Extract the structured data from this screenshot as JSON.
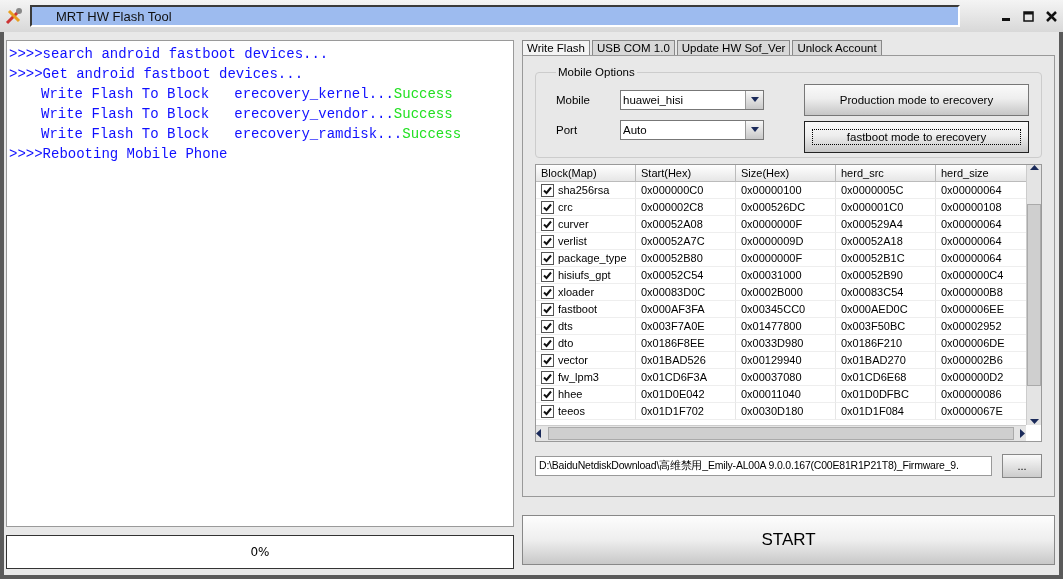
{
  "window": {
    "title": "MRT HW Flash Tool"
  },
  "log": [
    {
      "kind": "prompt",
      "parts": [
        {
          "text": ">>>>search android fastboot devices..."
        }
      ]
    },
    {
      "kind": "prompt",
      "parts": [
        {
          "text": ">>>>Get android fastboot devices..."
        }
      ]
    },
    {
      "kind": "step",
      "parts": [
        {
          "text": "Write Flash To Block   erecovery_kernel..."
        },
        {
          "text": "Success",
          "kind": "success"
        }
      ]
    },
    {
      "kind": "step",
      "parts": [
        {
          "text": "Write Flash To Block   erecovery_vendor..."
        },
        {
          "text": "Success",
          "kind": "success"
        }
      ]
    },
    {
      "kind": "step",
      "parts": [
        {
          "text": "Write Flash To Block   erecovery_ramdisk..."
        },
        {
          "text": "Success",
          "kind": "success"
        }
      ]
    },
    {
      "kind": "prompt",
      "parts": [
        {
          "text": ">>>>Rebooting Mobile Phone"
        }
      ]
    }
  ],
  "progress": {
    "level": 0,
    "reading": "0%"
  },
  "tabs": [
    {
      "label": "Write Flash",
      "selected": true
    },
    {
      "label": "USB COM 1.0",
      "selected": false
    },
    {
      "label": "Update HW Sof_Ver",
      "selected": false
    },
    {
      "label": "Unlock Account",
      "selected": false
    }
  ],
  "mobile_options": {
    "title": "Mobile Options",
    "fields": [
      {
        "label": "Mobile",
        "value": "huawei_hisi"
      },
      {
        "label": "Port",
        "value": "Auto"
      }
    ],
    "buttons": [
      {
        "label": "Production mode to erecovery",
        "focused": false
      },
      {
        "label": "fastboot mode to erecovery",
        "focused": true
      }
    ]
  },
  "table": {
    "columns": [
      "Block(Map)",
      "Start(Hex)",
      "Size(Hex)",
      "herd_src",
      "herd_size"
    ],
    "rows": [
      {
        "checked": true,
        "cells": [
          "sha256rsa",
          "0x000000C0",
          "0x00000100",
          "0x0000005C",
          "0x00000064"
        ]
      },
      {
        "checked": true,
        "cells": [
          "crc",
          "0x000002C8",
          "0x000526DC",
          "0x000001C0",
          "0x00000108"
        ]
      },
      {
        "checked": true,
        "cells": [
          "curver",
          "0x00052A08",
          "0x0000000F",
          "0x000529A4",
          "0x00000064"
        ]
      },
      {
        "checked": true,
        "cells": [
          "verlist",
          "0x00052A7C",
          "0x0000009D",
          "0x00052A18",
          "0x00000064"
        ]
      },
      {
        "checked": true,
        "cells": [
          "package_type",
          "0x00052B80",
          "0x0000000F",
          "0x00052B1C",
          "0x00000064"
        ]
      },
      {
        "checked": true,
        "cells": [
          "hisiufs_gpt",
          "0x00052C54",
          "0x00031000",
          "0x00052B90",
          "0x000000C4"
        ]
      },
      {
        "checked": true,
        "cells": [
          "xloader",
          "0x00083D0C",
          "0x0002B000",
          "0x00083C54",
          "0x000000B8"
        ]
      },
      {
        "checked": true,
        "cells": [
          "fastboot",
          "0x000AF3FA",
          "0x00345CC0",
          "0x000AED0C",
          "0x000006EE"
        ]
      },
      {
        "checked": true,
        "cells": [
          "dts",
          "0x003F7A0E",
          "0x01477800",
          "0x003F50BC",
          "0x00002952"
        ]
      },
      {
        "checked": true,
        "cells": [
          "dto",
          "0x0186F8EE",
          "0x0033D980",
          "0x0186F210",
          "0x000006DE"
        ]
      },
      {
        "checked": true,
        "cells": [
          "vector",
          "0x01BAD526",
          "0x00129940",
          "0x01BAD270",
          "0x000002B6"
        ]
      },
      {
        "checked": true,
        "cells": [
          "fw_lpm3",
          "0x01CD6F3A",
          "0x00037080",
          "0x01CD6E68",
          "0x000000D2"
        ]
      },
      {
        "checked": true,
        "cells": [
          "hhee",
          "0x01D0E042",
          "0x00011040",
          "0x01D0DFBC",
          "0x00000086"
        ]
      },
      {
        "checked": true,
        "cells": [
          "teeos",
          "0x01D1F702",
          "0x0030D180",
          "0x01D1F084",
          "0x0000067E"
        ]
      }
    ]
  },
  "file_path": {
    "value": "D:\\BaiduNetdiskDownload\\高维禁用_Emily-AL00A 9.0.0.167(C00E81R1P21T8)_Firmware_9.",
    "browse_label": "..."
  },
  "start_button": {
    "label": "START"
  }
}
